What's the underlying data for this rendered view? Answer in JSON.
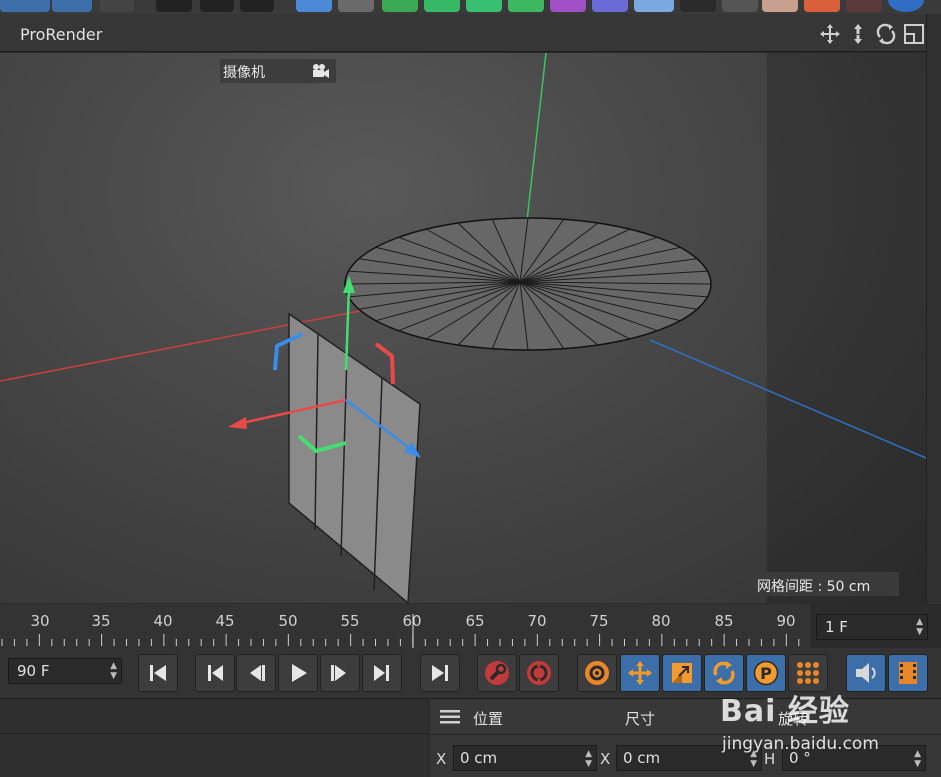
{
  "viewport": {
    "title": "ProRender",
    "camera_label": "摄像机",
    "grid_spacing": "网格间距 : 50 cm"
  },
  "timeline": {
    "ticks": [
      "30",
      "35",
      "40",
      "45",
      "50",
      "55",
      "60",
      "65",
      "70",
      "75",
      "80",
      "85",
      "90"
    ],
    "current_frame": "1 F",
    "end_frame": "90 F"
  },
  "attributes": {
    "position_label": "位置",
    "size_label": "尺寸",
    "rotation_label": "旋转",
    "pos_x_axis": "X",
    "pos_x_value": "0 cm",
    "size_x_axis": "X",
    "size_x_value": "0 cm",
    "rot_h_axis": "H",
    "rot_h_value": "0 °"
  },
  "watermark": {
    "main": "Bai 经验",
    "sub": "jingyan.baidu.com"
  },
  "colors": {
    "x_axis": "#d9423e",
    "y_axis": "#3fcf6b",
    "z_axis": "#2f7fd6",
    "accent_blue": "#3c6ea9",
    "record_red": "#c23a3a",
    "key_orange": "#e8862a"
  }
}
